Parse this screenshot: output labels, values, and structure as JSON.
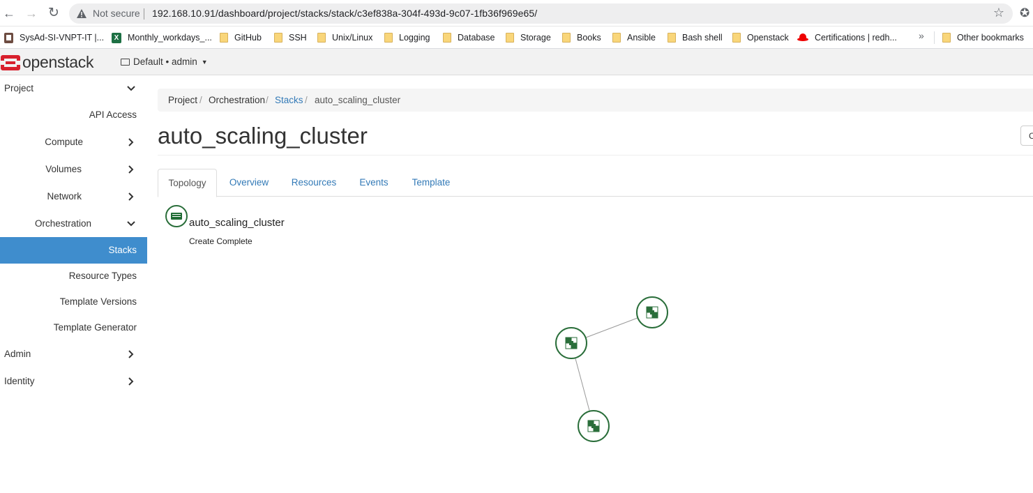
{
  "browser": {
    "security_label": "Not secure",
    "url": "192.168.10.91/dashboard/project/stacks/stack/c3ef838a-304f-493d-9c07-1fb36f969e65/",
    "bookmarks": [
      {
        "label": "SysAd-SI-VNPT-IT |...",
        "icon": "book"
      },
      {
        "label": "Monthly_workdays_...",
        "icon": "excel"
      },
      {
        "label": "GitHub",
        "icon": "folder"
      },
      {
        "label": "SSH",
        "icon": "folder"
      },
      {
        "label": "Unix/Linux",
        "icon": "folder"
      },
      {
        "label": "Logging",
        "icon": "folder"
      },
      {
        "label": "Database",
        "icon": "folder"
      },
      {
        "label": "Storage",
        "icon": "folder"
      },
      {
        "label": "Books",
        "icon": "folder"
      },
      {
        "label": "Ansible",
        "icon": "folder"
      },
      {
        "label": "Bash shell",
        "icon": "folder"
      },
      {
        "label": "Openstack",
        "icon": "folder"
      },
      {
        "label": "Certifications | redh...",
        "icon": "redhat"
      }
    ],
    "more_label": "»",
    "other_bookmarks": "Other bookmarks"
  },
  "header": {
    "logo_text": "openstack",
    "context_label": "Default • admin"
  },
  "sidebar": {
    "items": [
      {
        "label": "Project",
        "chevron": "down"
      },
      {
        "label": "API Access",
        "chevron": ""
      },
      {
        "label": "Compute",
        "chevron": "right"
      },
      {
        "label": "Volumes",
        "chevron": "right"
      },
      {
        "label": "Network",
        "chevron": "right"
      },
      {
        "label": "Orchestration",
        "chevron": "down"
      },
      {
        "label": "Stacks",
        "chevron": "",
        "active": true
      },
      {
        "label": "Resource Types",
        "chevron": ""
      },
      {
        "label": "Template Versions",
        "chevron": ""
      },
      {
        "label": "Template Generator",
        "chevron": ""
      },
      {
        "label": "Admin",
        "chevron": "right"
      },
      {
        "label": "Identity",
        "chevron": "right"
      }
    ]
  },
  "breadcrumb": [
    "Project",
    "Orchestration",
    "Stacks",
    "auto_scaling_cluster"
  ],
  "page": {
    "title": "auto_scaling_cluster",
    "right_button": "C"
  },
  "tabs": [
    {
      "label": "Topology",
      "active": true
    },
    {
      "label": "Overview"
    },
    {
      "label": "Resources"
    },
    {
      "label": "Events"
    },
    {
      "label": "Template"
    }
  ],
  "topology": {
    "stack_name": "auto_scaling_cluster",
    "stack_status": "Create Complete",
    "resource_count": 3,
    "links": [
      [
        0,
        1
      ],
      [
        0,
        2
      ]
    ]
  },
  "colors": {
    "active_nav": "#3f8dcd",
    "link": "#337ab7",
    "node_green": "#2a6e3a",
    "logo_red": "#d8202d"
  }
}
